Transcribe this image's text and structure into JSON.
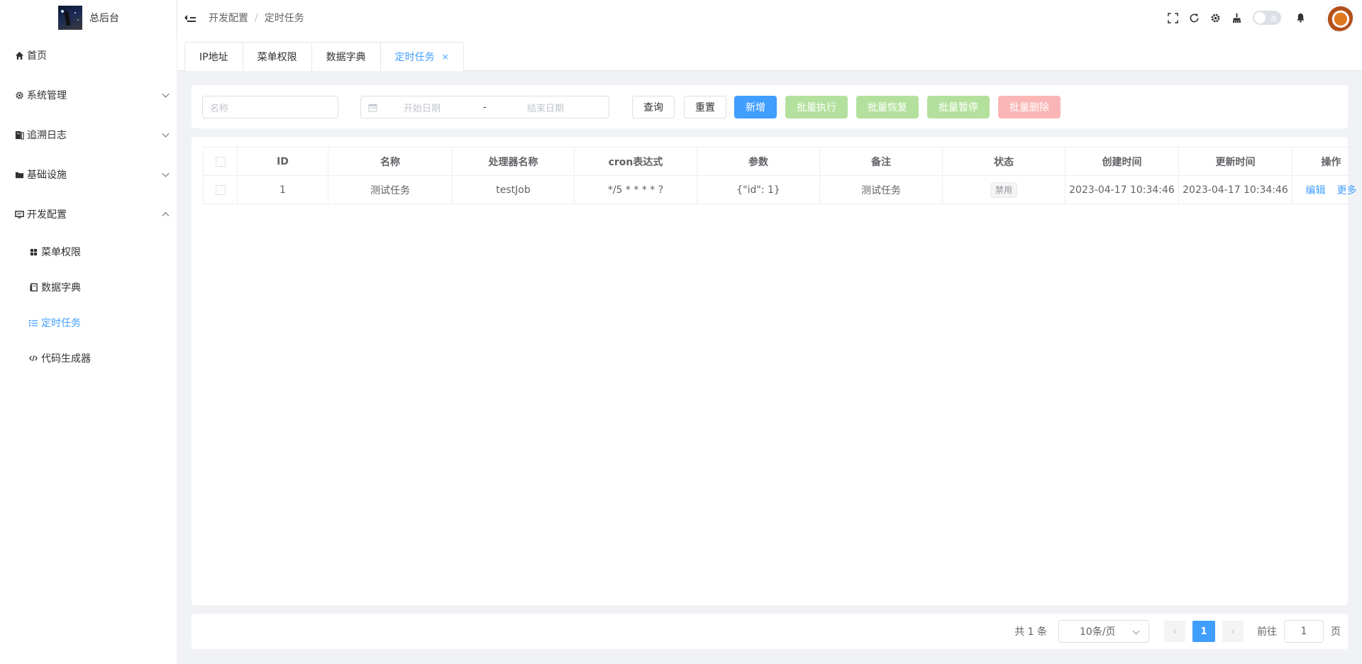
{
  "app": {
    "title": "总后台"
  },
  "sidebar": {
    "items": [
      {
        "label": "首页",
        "icon": "home-icon"
      },
      {
        "label": "系统管理",
        "icon": "gear-icon"
      },
      {
        "label": "追溯日志",
        "icon": "log-icon"
      },
      {
        "label": "基础设施",
        "icon": "folder-icon"
      },
      {
        "label": "开发配置",
        "icon": "monitor-icon"
      }
    ],
    "dev_sub_items": [
      {
        "label": "菜单权限",
        "icon": "grid-icon"
      },
      {
        "label": "数据字典",
        "icon": "book-icon"
      },
      {
        "label": "定时任务",
        "icon": "list-icon",
        "active": true
      },
      {
        "label": "代码生成器",
        "icon": "code-icon"
      }
    ]
  },
  "header": {
    "breadcrumb": [
      "开发配置",
      "定时任务"
    ],
    "breadcrumb_sep": "/",
    "toggle_label": "关"
  },
  "tabs": [
    {
      "label": "IP地址"
    },
    {
      "label": "菜单权限"
    },
    {
      "label": "数据字典"
    },
    {
      "label": "定时任务",
      "active": true,
      "close": "×"
    }
  ],
  "filter": {
    "name_placeholder": "名称",
    "start_date_placeholder": "开始日期",
    "date_sep": "-",
    "end_date_placeholder": "结束日期",
    "query": "查询",
    "reset": "重置",
    "add": "新增",
    "batch_run": "批量执行",
    "batch_resume": "批量恢复",
    "batch_pause": "批量暂停",
    "batch_delete": "批量删除"
  },
  "table": {
    "columns": [
      "ID",
      "名称",
      "处理器名称",
      "cron表达式",
      "参数",
      "备注",
      "状态",
      "创建时间",
      "更新时间",
      "操作"
    ],
    "rows": [
      {
        "id": "1",
        "name": "测试任务",
        "handler": "testJob",
        "cron": "*/5 * * * * ?",
        "params": "{\"id\": 1}",
        "remark": "测试任务",
        "status": "禁用",
        "created": "2023-04-17 10:34:46",
        "updated": "2023-04-17 10:34:46",
        "edit": "编辑",
        "more": "更多"
      }
    ]
  },
  "pager": {
    "total": "共 1 条",
    "page_size": "10条/页",
    "prev": "‹",
    "current": "1",
    "next": "›",
    "goto": "前往",
    "goto_value": "1",
    "page_suffix": "页"
  }
}
